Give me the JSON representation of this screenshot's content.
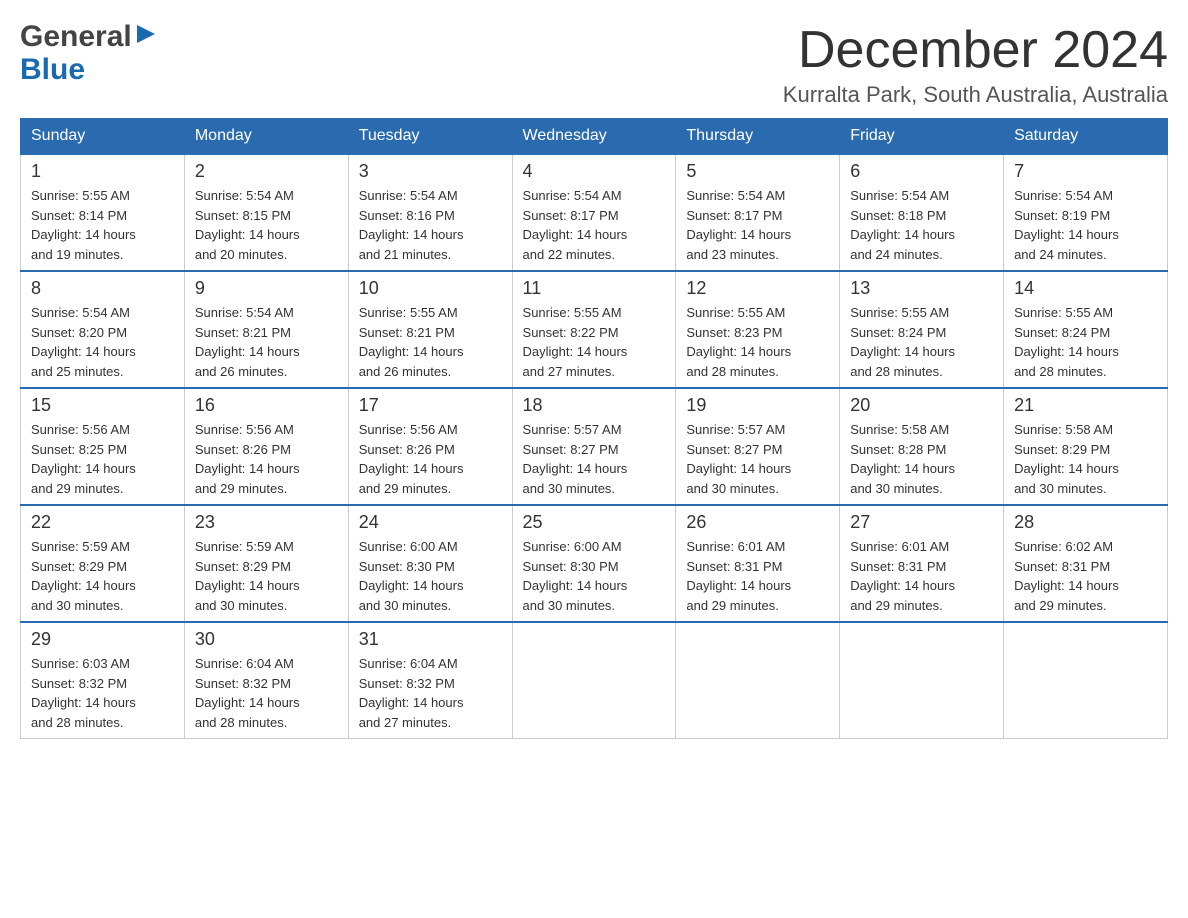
{
  "header": {
    "month_year": "December 2024",
    "location": "Kurralta Park, South Australia, Australia",
    "logo_general": "General",
    "logo_blue": "Blue"
  },
  "days_of_week": [
    "Sunday",
    "Monday",
    "Tuesday",
    "Wednesday",
    "Thursday",
    "Friday",
    "Saturday"
  ],
  "weeks": [
    [
      {
        "day": "1",
        "sunrise": "5:55 AM",
        "sunset": "8:14 PM",
        "daylight": "14 hours and 19 minutes."
      },
      {
        "day": "2",
        "sunrise": "5:54 AM",
        "sunset": "8:15 PM",
        "daylight": "14 hours and 20 minutes."
      },
      {
        "day": "3",
        "sunrise": "5:54 AM",
        "sunset": "8:16 PM",
        "daylight": "14 hours and 21 minutes."
      },
      {
        "day": "4",
        "sunrise": "5:54 AM",
        "sunset": "8:17 PM",
        "daylight": "14 hours and 22 minutes."
      },
      {
        "day": "5",
        "sunrise": "5:54 AM",
        "sunset": "8:17 PM",
        "daylight": "14 hours and 23 minutes."
      },
      {
        "day": "6",
        "sunrise": "5:54 AM",
        "sunset": "8:18 PM",
        "daylight": "14 hours and 24 minutes."
      },
      {
        "day": "7",
        "sunrise": "5:54 AM",
        "sunset": "8:19 PM",
        "daylight": "14 hours and 24 minutes."
      }
    ],
    [
      {
        "day": "8",
        "sunrise": "5:54 AM",
        "sunset": "8:20 PM",
        "daylight": "14 hours and 25 minutes."
      },
      {
        "day": "9",
        "sunrise": "5:54 AM",
        "sunset": "8:21 PM",
        "daylight": "14 hours and 26 minutes."
      },
      {
        "day": "10",
        "sunrise": "5:55 AM",
        "sunset": "8:21 PM",
        "daylight": "14 hours and 26 minutes."
      },
      {
        "day": "11",
        "sunrise": "5:55 AM",
        "sunset": "8:22 PM",
        "daylight": "14 hours and 27 minutes."
      },
      {
        "day": "12",
        "sunrise": "5:55 AM",
        "sunset": "8:23 PM",
        "daylight": "14 hours and 28 minutes."
      },
      {
        "day": "13",
        "sunrise": "5:55 AM",
        "sunset": "8:24 PM",
        "daylight": "14 hours and 28 minutes."
      },
      {
        "day": "14",
        "sunrise": "5:55 AM",
        "sunset": "8:24 PM",
        "daylight": "14 hours and 28 minutes."
      }
    ],
    [
      {
        "day": "15",
        "sunrise": "5:56 AM",
        "sunset": "8:25 PM",
        "daylight": "14 hours and 29 minutes."
      },
      {
        "day": "16",
        "sunrise": "5:56 AM",
        "sunset": "8:26 PM",
        "daylight": "14 hours and 29 minutes."
      },
      {
        "day": "17",
        "sunrise": "5:56 AM",
        "sunset": "8:26 PM",
        "daylight": "14 hours and 29 minutes."
      },
      {
        "day": "18",
        "sunrise": "5:57 AM",
        "sunset": "8:27 PM",
        "daylight": "14 hours and 30 minutes."
      },
      {
        "day": "19",
        "sunrise": "5:57 AM",
        "sunset": "8:27 PM",
        "daylight": "14 hours and 30 minutes."
      },
      {
        "day": "20",
        "sunrise": "5:58 AM",
        "sunset": "8:28 PM",
        "daylight": "14 hours and 30 minutes."
      },
      {
        "day": "21",
        "sunrise": "5:58 AM",
        "sunset": "8:29 PM",
        "daylight": "14 hours and 30 minutes."
      }
    ],
    [
      {
        "day": "22",
        "sunrise": "5:59 AM",
        "sunset": "8:29 PM",
        "daylight": "14 hours and 30 minutes."
      },
      {
        "day": "23",
        "sunrise": "5:59 AM",
        "sunset": "8:29 PM",
        "daylight": "14 hours and 30 minutes."
      },
      {
        "day": "24",
        "sunrise": "6:00 AM",
        "sunset": "8:30 PM",
        "daylight": "14 hours and 30 minutes."
      },
      {
        "day": "25",
        "sunrise": "6:00 AM",
        "sunset": "8:30 PM",
        "daylight": "14 hours and 30 minutes."
      },
      {
        "day": "26",
        "sunrise": "6:01 AM",
        "sunset": "8:31 PM",
        "daylight": "14 hours and 29 minutes."
      },
      {
        "day": "27",
        "sunrise": "6:01 AM",
        "sunset": "8:31 PM",
        "daylight": "14 hours and 29 minutes."
      },
      {
        "day": "28",
        "sunrise": "6:02 AM",
        "sunset": "8:31 PM",
        "daylight": "14 hours and 29 minutes."
      }
    ],
    [
      {
        "day": "29",
        "sunrise": "6:03 AM",
        "sunset": "8:32 PM",
        "daylight": "14 hours and 28 minutes."
      },
      {
        "day": "30",
        "sunrise": "6:04 AM",
        "sunset": "8:32 PM",
        "daylight": "14 hours and 28 minutes."
      },
      {
        "day": "31",
        "sunrise": "6:04 AM",
        "sunset": "8:32 PM",
        "daylight": "14 hours and 27 minutes."
      },
      null,
      null,
      null,
      null
    ]
  ],
  "labels": {
    "sunrise": "Sunrise:",
    "sunset": "Sunset:",
    "daylight": "Daylight:"
  }
}
